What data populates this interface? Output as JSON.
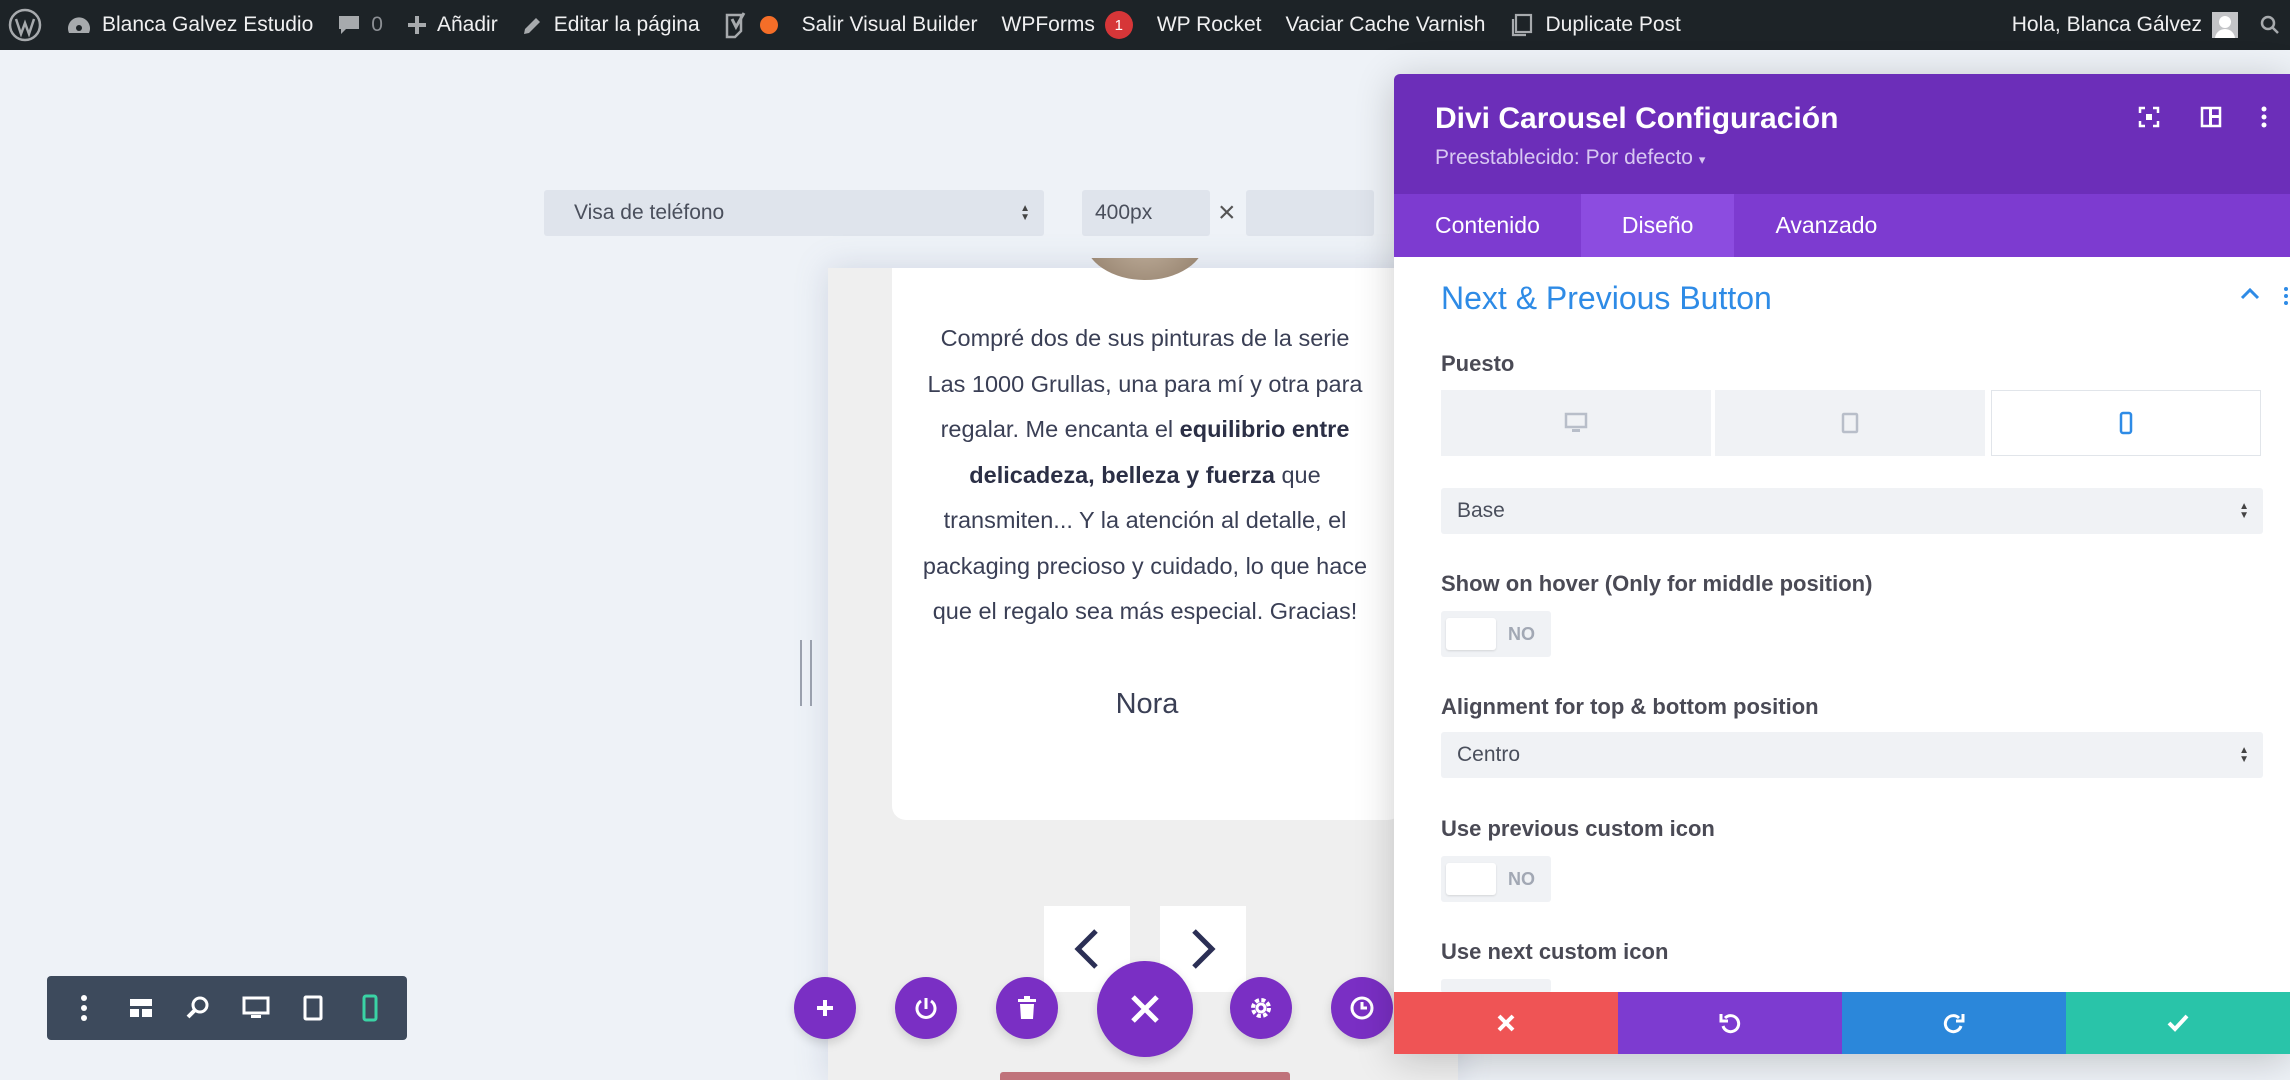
{
  "adminbar": {
    "site_name": "Blanca Galvez Estudio",
    "comments_count": "0",
    "add_label": "Añadir",
    "edit_label": "Editar la página",
    "exit_builder": "Salir Visual Builder",
    "wpforms": "WPForms",
    "wpforms_badge": "1",
    "wprocket": "WP Rocket",
    "varnish": "Vaciar Cache Varnish",
    "duplicate": "Duplicate Post",
    "greeting": "Hola, Blanca Gálvez"
  },
  "responsive": {
    "view_select": "Visa de teléfono",
    "width_value": "400px",
    "separator": "×",
    "height_value": ""
  },
  "preview": {
    "quote_parts": [
      "Compré dos de sus pinturas de la serie Las 1000 Grullas, una para mí y otra para regalar. Me encanta el ",
      "equilibrio entre delicadeza, belleza y fuerza",
      " que transmiten... Y la atención al detalle, el packaging precioso y cuidado, lo que hace que el regalo sea más especial. Gracias!"
    ],
    "author": "Nora"
  },
  "modal": {
    "title": "Divi Carousel Configuración",
    "preset": "Preestablecido: Por defecto",
    "tabs": [
      "Contenido",
      "Diseño",
      "Avanzado"
    ],
    "active_tab": "Diseño",
    "section_title": "Next & Previous Button",
    "puesto_label": "Puesto",
    "position_select": "Base",
    "show_hover_label": "Show on hover (Only for middle position)",
    "show_hover_value": "NO",
    "alignment_label": "Alignment for top & bottom position",
    "alignment_select": "Centro",
    "prev_icon_label": "Use previous custom icon",
    "prev_icon_value": "NO",
    "next_icon_label": "Use next custom icon"
  },
  "colors": {
    "purple": "#6c2eb9",
    "accent_blue": "#2e8be6",
    "cancel": "#ef5455",
    "undo": "#7d3bd0",
    "redo": "#2b87da",
    "save": "#29c4a9"
  },
  "icons": [
    "wordpress-icon",
    "dashboard-icon",
    "comment-icon",
    "plus-icon",
    "pencil-icon",
    "yoast-icon",
    "duplicate-icon",
    "chevron-left-icon",
    "chevron-right-icon",
    "desktop-icon",
    "tablet-icon",
    "phone-icon",
    "close-icon",
    "undo-icon",
    "redo-icon",
    "check-icon"
  ]
}
